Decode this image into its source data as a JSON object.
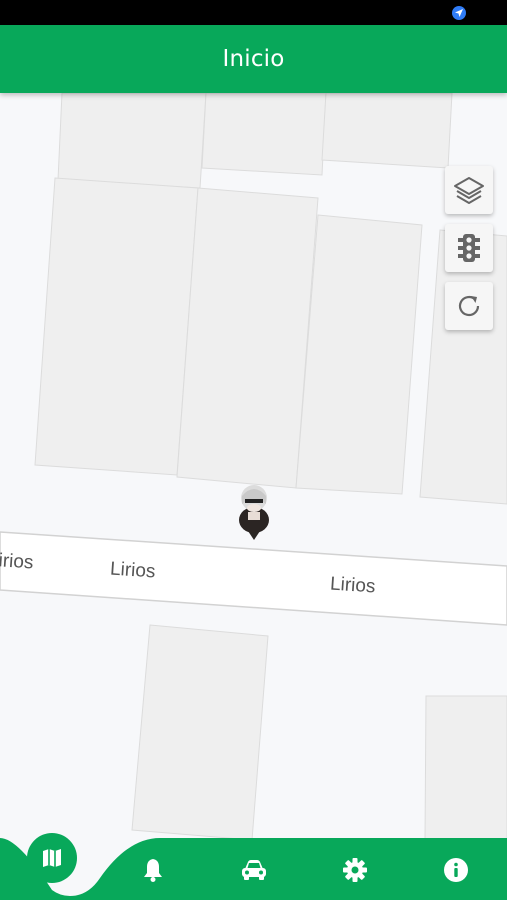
{
  "status_bar": {
    "location_icon": "navigation-arrow-icon"
  },
  "app_bar": {
    "title": "Inicio",
    "color": "#08a85a"
  },
  "map": {
    "streets": [
      {
        "label": "Lirios"
      },
      {
        "label": "Lirios"
      },
      {
        "label": "Lirios"
      }
    ],
    "controls": [
      {
        "name": "layers-button",
        "icon": "layers-icon"
      },
      {
        "name": "traffic-button",
        "icon": "traffic-light-icon"
      },
      {
        "name": "refresh-button",
        "icon": "refresh-icon"
      }
    ],
    "user_marker": {
      "icon": "avatar"
    }
  },
  "bottom_nav": {
    "active_color": "#08a85a",
    "items": [
      {
        "name": "map",
        "icon": "map-icon",
        "active": true
      },
      {
        "name": "notifications",
        "icon": "bell-icon"
      },
      {
        "name": "vehicle",
        "icon": "car-icon"
      },
      {
        "name": "settings",
        "icon": "gear-icon"
      },
      {
        "name": "info",
        "icon": "info-icon"
      }
    ]
  }
}
